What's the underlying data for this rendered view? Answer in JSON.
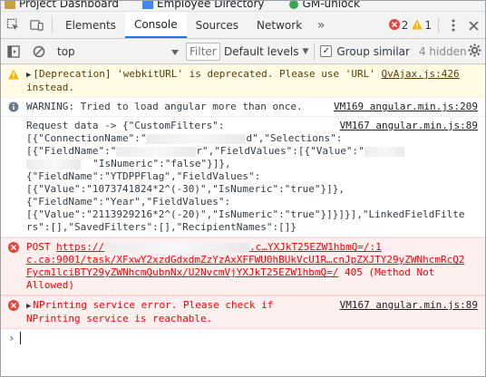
{
  "bookmarks": [
    {
      "label": "Project Dashboard",
      "icon": "project-icon"
    },
    {
      "label": "Employee Directory",
      "icon": "directory-icon"
    },
    {
      "label": "GM-unlock",
      "icon": "unlock-icon"
    }
  ],
  "tabs": [
    {
      "label": "Elements",
      "active": false
    },
    {
      "label": "Console",
      "active": true
    },
    {
      "label": "Sources",
      "active": false
    },
    {
      "label": "Network",
      "active": false
    }
  ],
  "tab_more": "»",
  "counts": {
    "errors": "2",
    "warnings": "1"
  },
  "toolbar": {
    "context": "top",
    "filter_placeholder": "Filter",
    "levels": "Default levels",
    "group_similar": "Group similar",
    "hidden": "4 hidden"
  },
  "messages": {
    "deprecation": {
      "line1": "[Deprecation] 'webkitURL' is deprecated. Please use 'URL'",
      "line2": "instead.",
      "source": "QvAjax.js:426"
    },
    "warning_angular": {
      "text": "WARNING: Tried to load angular more than once.",
      "source": "VM169 angular.min.js:209"
    },
    "request": {
      "source": "VM167 angular.min.js:89",
      "lines": [
        "Request data -> {\"CustomFilters\":",
        "[{\"ConnectionName\":\"",
        "[{\"FieldName\":\"",
        "  \"IsNumeric\":\"false\"}]},",
        "{\"FieldName\":\"YTDPPFlag\",\"FieldValues\":",
        "[{\"Value\":\"1073741824*2^(-30)\",\"IsNumeric\":\"true\"}]},",
        "{\"FieldName\":\"Year\",\"FieldValues\":",
        "[{\"Value\":\"2113929216*2^(-20)\",\"IsNumeric\":\"true\"}]}]}],\"LinkedFieldFilte",
        "rs\":[],\"SavedFilters\":[],\"RecipientNames\":[]}"
      ],
      "frag_selections": "d\",\"Selections\":",
      "frag_fieldvalues": "r\",\"FieldValues\":[{\"Value\":\""
    },
    "post_error": {
      "method": "POST",
      "url_start": "https://",
      "url_tail": ".c…YXJkT25EZW1hbmQ=/:1",
      "url_lines": [
        "c.ca:9001/task/XFxwY2xzdGdxdmZzYzAxXFFWU0hBUkVcU1R…cnJpZXJTY29yZWNhcmRcQ2",
        "Fycm1lciBTY29yZWNhcmQubnNx/U2NvcmVjYXJkT25EZW1hbmQ=/"
      ],
      "status_inline": "405 (Method Not",
      "status_line2": "Allowed)"
    },
    "nprinting_error": {
      "line1": "NPrinting service error. Please check if",
      "line2": "NPrinting service is reachable.",
      "source": "VM167 angular.min.js:89"
    }
  },
  "colors": {
    "accent": "#1a73e8",
    "error": "#ff0000",
    "warning_bg": "#fffbe5",
    "error_bg": "#fff0f0"
  }
}
